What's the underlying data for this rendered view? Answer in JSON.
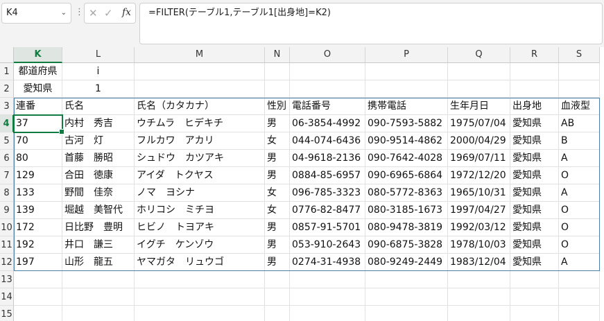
{
  "name_box": {
    "value": "K4"
  },
  "formula_bar": {
    "formula": "=FILTER(テーブル1,テーブル1[出身地]=K2)"
  },
  "columns": [
    "K",
    "L",
    "M",
    "N",
    "O",
    "P",
    "Q",
    "R",
    "S"
  ],
  "rows": [
    "1",
    "2",
    "3",
    "4",
    "5",
    "6",
    "7",
    "8",
    "9",
    "10",
    "11",
    "12",
    "13",
    "14",
    "15"
  ],
  "criteria": {
    "r1": [
      "都道府県",
      "i"
    ],
    "r2": [
      "愛知県",
      "1"
    ]
  },
  "table": {
    "headers": [
      "連番",
      "氏名",
      "氏名（カタカナ）",
      "性別",
      "電話番号",
      "携帯電話",
      "生年月日",
      "出身地",
      "血液型"
    ],
    "rows": [
      [
        "37",
        "内村　秀吉",
        "ウチムラ　ヒデキチ",
        "男",
        "06-3854-4992",
        "090-7593-5882",
        "1975/07/04",
        "愛知県",
        "AB"
      ],
      [
        "70",
        "古河　灯",
        "フルカワ　アカリ",
        "女",
        "044-074-6436",
        "090-9514-4862",
        "2000/04/29",
        "愛知県",
        "B"
      ],
      [
        "80",
        "首藤　勝昭",
        "シュドウ　カツアキ",
        "男",
        "04-9618-2136",
        "090-7642-4028",
        "1969/07/11",
        "愛知県",
        "A"
      ],
      [
        "129",
        "合田　徳康",
        "アイダ　トクヤス",
        "男",
        "0884-85-6957",
        "090-6965-6864",
        "1972/12/20",
        "愛知県",
        "O"
      ],
      [
        "133",
        "野間　佳奈",
        "ノマ　ヨシナ",
        "女",
        "096-785-3323",
        "080-5772-8363",
        "1965/10/31",
        "愛知県",
        "A"
      ],
      [
        "139",
        "堀越　美智代",
        "ホリコシ　ミチヨ",
        "女",
        "0776-82-8477",
        "080-3185-1673",
        "1997/04/27",
        "愛知県",
        "O"
      ],
      [
        "172",
        "日比野　豊明",
        "ヒビノ　トヨアキ",
        "男",
        "0857-91-5701",
        "080-9478-3819",
        "1992/03/12",
        "愛知県",
        "O"
      ],
      [
        "192",
        "井口　謙三",
        "イグチ　ケンゾウ",
        "男",
        "053-910-2643",
        "090-6875-3828",
        "1978/10/03",
        "愛知県",
        "O"
      ],
      [
        "197",
        "山形　龍五",
        "ヤマガタ　リュウゴ",
        "男",
        "0274-31-4938",
        "080-9249-2449",
        "1983/12/04",
        "愛知県",
        "A"
      ]
    ]
  }
}
